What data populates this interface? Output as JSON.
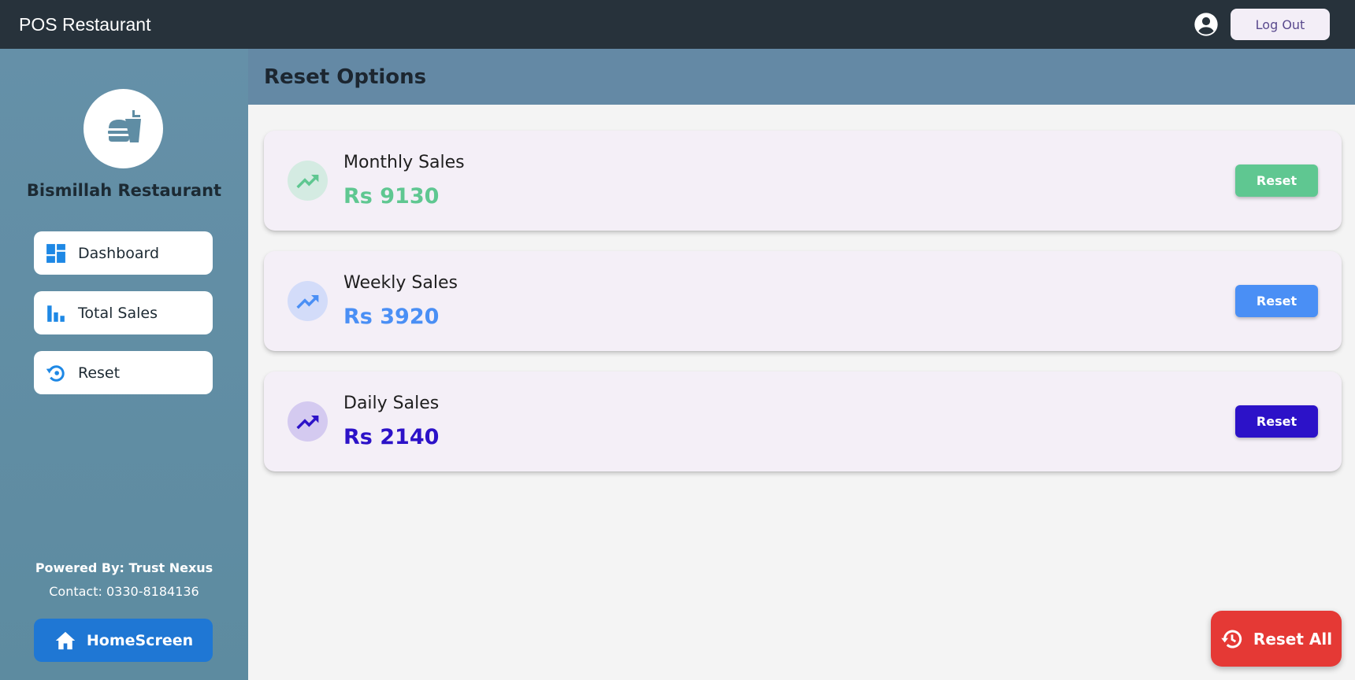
{
  "appbar": {
    "title": "POS Restaurant",
    "user_icon": "account-circle-icon",
    "logout_label": "Log Out"
  },
  "sidebar": {
    "logo_icon": "fastfood-icon",
    "restaurant_name": "Bismillah Restaurant",
    "items": [
      {
        "label": "Dashboard",
        "icon": "dashboard-icon"
      },
      {
        "label": "Total Sales",
        "icon": "bar-chart-icon"
      },
      {
        "label": "Reset",
        "icon": "reset-icon"
      }
    ],
    "powered_by": "Powered By: Trust Nexus",
    "contact": "Contact: 0330-8184136",
    "home_button_label": "HomeScreen",
    "home_icon": "home-icon"
  },
  "main": {
    "title": "Reset Options",
    "cards": [
      {
        "label": "Monthly Sales",
        "value": "Rs 9130",
        "button_label": "Reset",
        "accent": "#5fc791",
        "icon_bg": "#d4ebe2",
        "icon": "trending-up-icon"
      },
      {
        "label": "Weekly Sales",
        "value": "Rs 3920",
        "button_label": "Reset",
        "accent": "#4a8ff5",
        "icon_bg": "#d3dcf9",
        "icon": "trending-up-icon"
      },
      {
        "label": "Daily Sales",
        "value": "Rs 2140",
        "button_label": "Reset",
        "accent": "#2c12c8",
        "icon_bg": "#d4caf0",
        "icon": "trending-up-icon"
      }
    ],
    "reset_all_label": "Reset All",
    "reset_all_icon": "history-icon"
  },
  "colors": {
    "appbar_bg": "#27323b",
    "sidebar_bg": "#6590a8",
    "header_bg": "#6489a5",
    "home_button": "#1f77d4",
    "reset_all": "#e53935",
    "nav_icon": "#1e88e5"
  }
}
